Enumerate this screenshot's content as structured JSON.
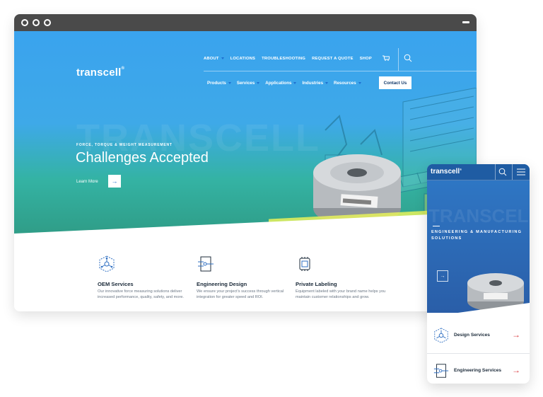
{
  "desktop": {
    "logo": "transcell",
    "logo_mark": "®",
    "top_nav": [
      "ABOUT",
      "LOCATIONS",
      "TROUBLESHOOTING",
      "REQUEST A QUOTE",
      "SHOP"
    ],
    "main_nav": [
      "Products",
      "Services",
      "Applications",
      "Industries",
      "Resources"
    ],
    "contact_label": "Contact Us",
    "hero": {
      "watermark": "TRANSCELL",
      "eyebrow": "FORCE, TORQUE & WEIGHT MEASUREMENT",
      "headline": "Challenges Accepted",
      "cta": "Learn More",
      "cta_arrow": "→"
    },
    "features": [
      {
        "title": "OEM Services",
        "text": "Our innovative force measuring solutions deliver increased performance, quality, safety, and more."
      },
      {
        "title": "Engineering Design",
        "text": "We ensure your project's success through vertical integration for greater speed and ROI."
      },
      {
        "title": "Private Labeling",
        "text": "Equipment labeled with your brand name helps you maintain customer relationships and grow."
      }
    ],
    "colors": {
      "accent": "#1f6fd0",
      "hero_top": "#3aa3ee",
      "hero_bottom": "#2f9c86"
    }
  },
  "mobile": {
    "logo": "transcell",
    "logo_mark": "®",
    "watermark": "TRANSCELL",
    "title": "ENGINEERING & MANUFACTURING SOLUTIONS",
    "arrow": "→",
    "rows": [
      {
        "label": "Design Services",
        "arrow": "→"
      },
      {
        "label": "Engineering Services",
        "arrow": "→"
      }
    ]
  }
}
